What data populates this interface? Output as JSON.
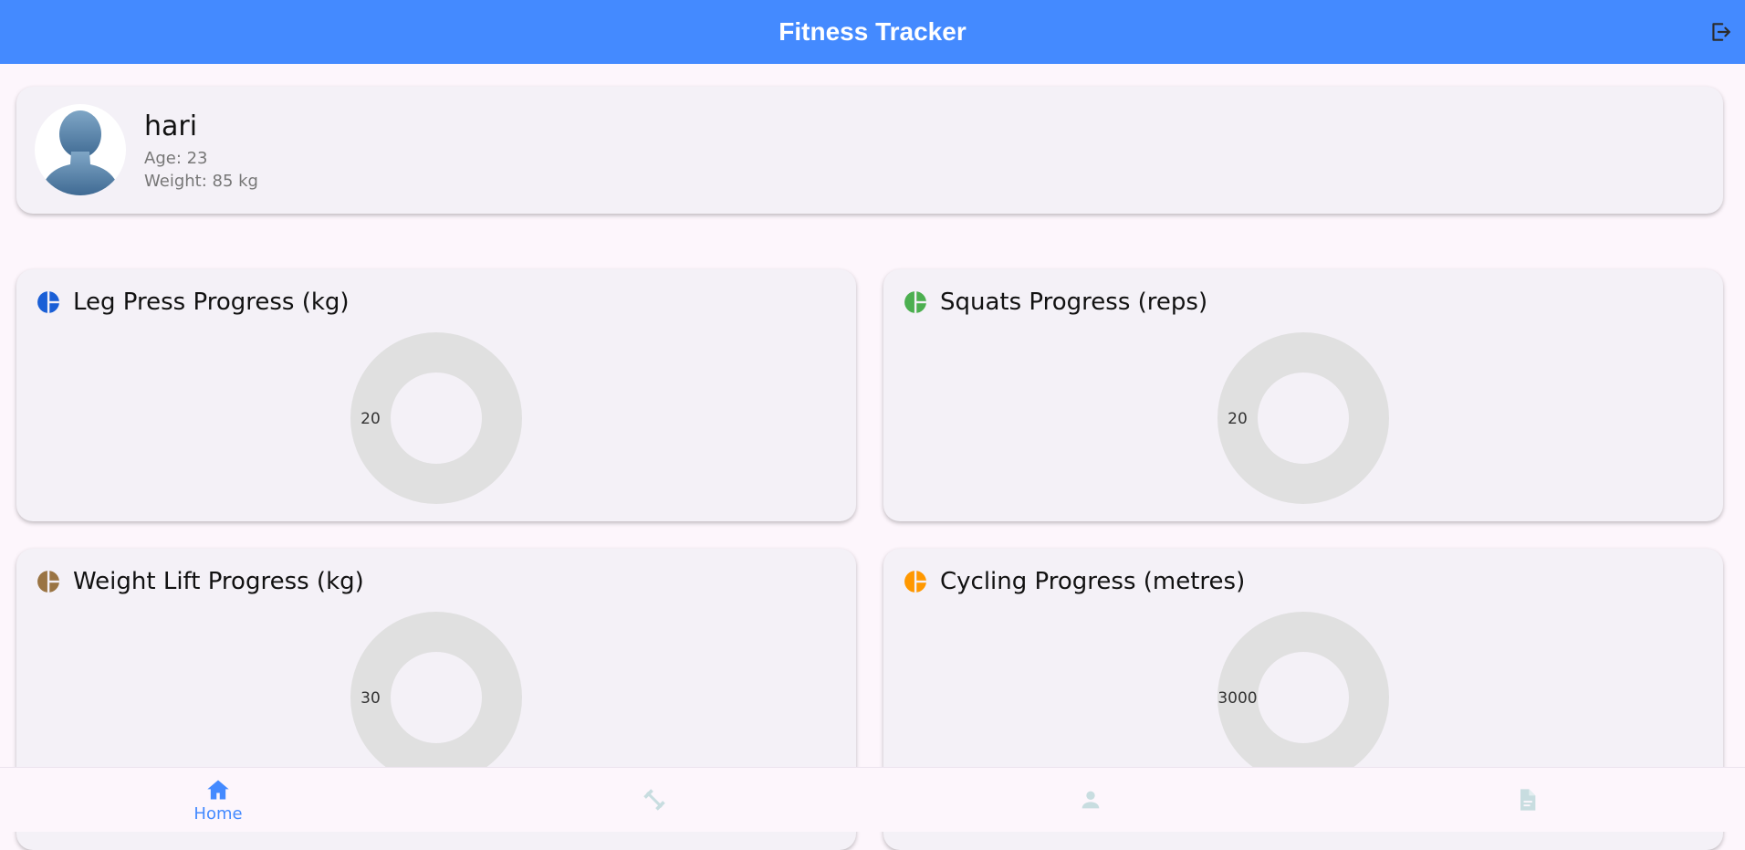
{
  "app_bar": {
    "title": "Fitness Tracker",
    "logout_icon": "logout-icon",
    "bg_color": "#448aff"
  },
  "profile": {
    "name": "hari",
    "age_text": "Age: 23",
    "weight_text": "Weight: 85 kg",
    "avatar_icon": "person-silhouette-avatar"
  },
  "charts": [
    {
      "title": "Leg Press Progress (kg)",
      "icon": "pie-chart-icon",
      "color": "#1a5fd6"
    },
    {
      "title": "Squats Progress (reps)",
      "icon": "pie-chart-icon",
      "color": "#4caf50"
    },
    {
      "title": "Weight Lift Progress (kg)",
      "icon": "pie-chart-icon",
      "color": "#9a7443"
    },
    {
      "title": "Cycling Progress (metres)",
      "icon": "pie-chart-icon",
      "color": "#ff9800"
    }
  ],
  "chart_data": [
    {
      "type": "pie",
      "title": "Leg Press Progress (kg)",
      "slices": [
        {
          "label": "20",
          "value": 20
        }
      ],
      "color": "#e0e0e0"
    },
    {
      "type": "pie",
      "title": "Squats Progress (reps)",
      "slices": [
        {
          "label": "20",
          "value": 20
        }
      ],
      "color": "#e0e0e0"
    },
    {
      "type": "pie",
      "title": "Weight Lift Progress (kg)",
      "slices": [
        {
          "label": "30",
          "value": 30
        }
      ],
      "color": "#e0e0e0"
    },
    {
      "type": "pie",
      "title": "Cycling Progress (metres)",
      "slices": [
        {
          "label": "3000",
          "value": 3000
        }
      ],
      "color": "#e0e0e0"
    }
  ],
  "bottom_nav": {
    "items": [
      {
        "label": "Home",
        "icon": "home-icon",
        "active": true
      },
      {
        "label": "",
        "icon": "dumbbell-icon",
        "active": false
      },
      {
        "label": "",
        "icon": "person-icon",
        "active": false
      },
      {
        "label": "",
        "icon": "document-icon",
        "active": false
      }
    ],
    "active_color": "#448aff",
    "inactive_color": "#c8dde0"
  }
}
